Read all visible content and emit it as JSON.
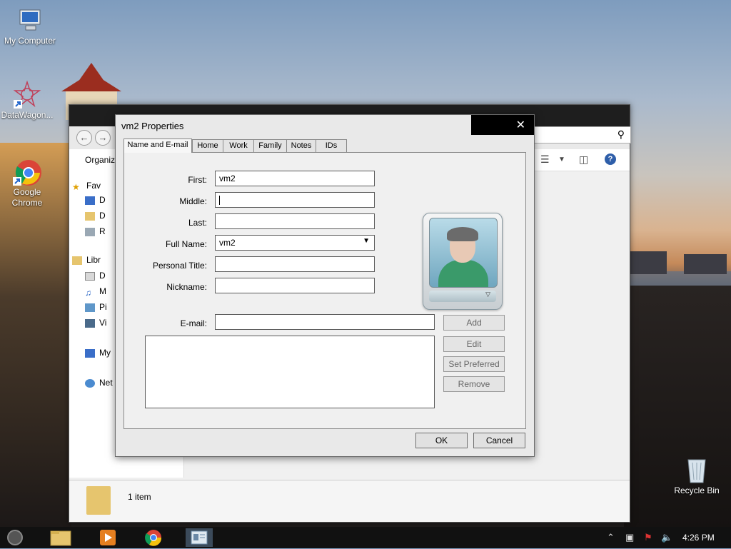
{
  "desktop": {
    "icons": [
      {
        "name": "My Computer"
      },
      {
        "name": "DataWagon..."
      },
      {
        "name": "Google Chrome"
      },
      {
        "name": "Recycle Bin"
      }
    ]
  },
  "explorer": {
    "organize": "Organiz",
    "sidebar": [
      "Fav",
      "D",
      "D",
      "R",
      "Libr",
      "D",
      "M",
      "Pi",
      "Vi",
      "My",
      "Net"
    ],
    "status": "1 item"
  },
  "dialog": {
    "title": "vm2 Properties",
    "close": "✕",
    "tabs": [
      "Name and E-mail",
      "Home",
      "Work",
      "Family",
      "Notes",
      "IDs"
    ],
    "labels": {
      "first": "First:",
      "middle": "Middle:",
      "last": "Last:",
      "full_name": "Full Name:",
      "personal_title": "Personal Title:",
      "nickname": "Nickname:",
      "email": "E-mail:"
    },
    "values": {
      "first": "vm2",
      "middle": "",
      "last": "",
      "full_name": "vm2",
      "personal_title": "",
      "nickname": "",
      "email": ""
    },
    "buttons": {
      "add": "Add",
      "edit": "Edit",
      "set_preferred": "Set Preferred",
      "remove": "Remove",
      "ok": "OK",
      "cancel": "Cancel"
    }
  },
  "taskbar": {
    "clock": "4:26 PM"
  }
}
